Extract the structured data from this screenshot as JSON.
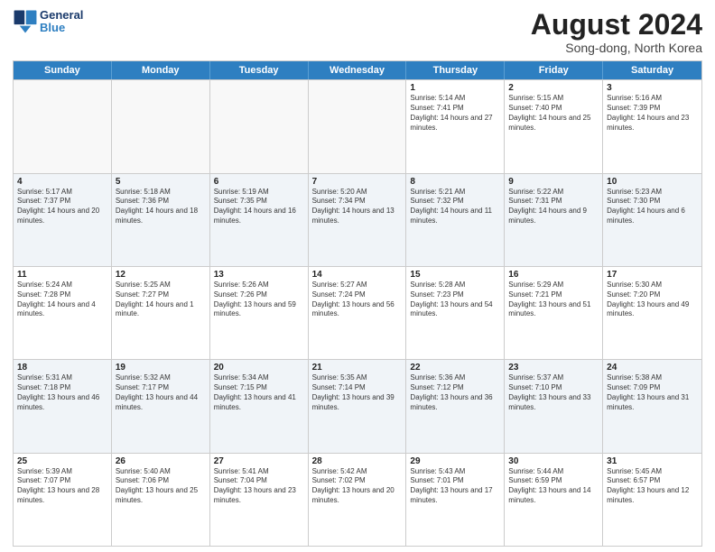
{
  "header": {
    "logo_general": "General",
    "logo_blue": "Blue",
    "month_title": "August 2024",
    "subtitle": "Song-dong, North Korea"
  },
  "calendar": {
    "days_of_week": [
      "Sunday",
      "Monday",
      "Tuesday",
      "Wednesday",
      "Thursday",
      "Friday",
      "Saturday"
    ],
    "weeks": [
      [
        {
          "day": "",
          "info": ""
        },
        {
          "day": "",
          "info": ""
        },
        {
          "day": "",
          "info": ""
        },
        {
          "day": "",
          "info": ""
        },
        {
          "day": "1",
          "sunrise": "Sunrise: 5:14 AM",
          "sunset": "Sunset: 7:41 PM",
          "daylight": "Daylight: 14 hours and 27 minutes."
        },
        {
          "day": "2",
          "sunrise": "Sunrise: 5:15 AM",
          "sunset": "Sunset: 7:40 PM",
          "daylight": "Daylight: 14 hours and 25 minutes."
        },
        {
          "day": "3",
          "sunrise": "Sunrise: 5:16 AM",
          "sunset": "Sunset: 7:39 PM",
          "daylight": "Daylight: 14 hours and 23 minutes."
        }
      ],
      [
        {
          "day": "4",
          "sunrise": "Sunrise: 5:17 AM",
          "sunset": "Sunset: 7:37 PM",
          "daylight": "Daylight: 14 hours and 20 minutes."
        },
        {
          "day": "5",
          "sunrise": "Sunrise: 5:18 AM",
          "sunset": "Sunset: 7:36 PM",
          "daylight": "Daylight: 14 hours and 18 minutes."
        },
        {
          "day": "6",
          "sunrise": "Sunrise: 5:19 AM",
          "sunset": "Sunset: 7:35 PM",
          "daylight": "Daylight: 14 hours and 16 minutes."
        },
        {
          "day": "7",
          "sunrise": "Sunrise: 5:20 AM",
          "sunset": "Sunset: 7:34 PM",
          "daylight": "Daylight: 14 hours and 13 minutes."
        },
        {
          "day": "8",
          "sunrise": "Sunrise: 5:21 AM",
          "sunset": "Sunset: 7:32 PM",
          "daylight": "Daylight: 14 hours and 11 minutes."
        },
        {
          "day": "9",
          "sunrise": "Sunrise: 5:22 AM",
          "sunset": "Sunset: 7:31 PM",
          "daylight": "Daylight: 14 hours and 9 minutes."
        },
        {
          "day": "10",
          "sunrise": "Sunrise: 5:23 AM",
          "sunset": "Sunset: 7:30 PM",
          "daylight": "Daylight: 14 hours and 6 minutes."
        }
      ],
      [
        {
          "day": "11",
          "sunrise": "Sunrise: 5:24 AM",
          "sunset": "Sunset: 7:28 PM",
          "daylight": "Daylight: 14 hours and 4 minutes."
        },
        {
          "day": "12",
          "sunrise": "Sunrise: 5:25 AM",
          "sunset": "Sunset: 7:27 PM",
          "daylight": "Daylight: 14 hours and 1 minute."
        },
        {
          "day": "13",
          "sunrise": "Sunrise: 5:26 AM",
          "sunset": "Sunset: 7:26 PM",
          "daylight": "Daylight: 13 hours and 59 minutes."
        },
        {
          "day": "14",
          "sunrise": "Sunrise: 5:27 AM",
          "sunset": "Sunset: 7:24 PM",
          "daylight": "Daylight: 13 hours and 56 minutes."
        },
        {
          "day": "15",
          "sunrise": "Sunrise: 5:28 AM",
          "sunset": "Sunset: 7:23 PM",
          "daylight": "Daylight: 13 hours and 54 minutes."
        },
        {
          "day": "16",
          "sunrise": "Sunrise: 5:29 AM",
          "sunset": "Sunset: 7:21 PM",
          "daylight": "Daylight: 13 hours and 51 minutes."
        },
        {
          "day": "17",
          "sunrise": "Sunrise: 5:30 AM",
          "sunset": "Sunset: 7:20 PM",
          "daylight": "Daylight: 13 hours and 49 minutes."
        }
      ],
      [
        {
          "day": "18",
          "sunrise": "Sunrise: 5:31 AM",
          "sunset": "Sunset: 7:18 PM",
          "daylight": "Daylight: 13 hours and 46 minutes."
        },
        {
          "day": "19",
          "sunrise": "Sunrise: 5:32 AM",
          "sunset": "Sunset: 7:17 PM",
          "daylight": "Daylight: 13 hours and 44 minutes."
        },
        {
          "day": "20",
          "sunrise": "Sunrise: 5:34 AM",
          "sunset": "Sunset: 7:15 PM",
          "daylight": "Daylight: 13 hours and 41 minutes."
        },
        {
          "day": "21",
          "sunrise": "Sunrise: 5:35 AM",
          "sunset": "Sunset: 7:14 PM",
          "daylight": "Daylight: 13 hours and 39 minutes."
        },
        {
          "day": "22",
          "sunrise": "Sunrise: 5:36 AM",
          "sunset": "Sunset: 7:12 PM",
          "daylight": "Daylight: 13 hours and 36 minutes."
        },
        {
          "day": "23",
          "sunrise": "Sunrise: 5:37 AM",
          "sunset": "Sunset: 7:10 PM",
          "daylight": "Daylight: 13 hours and 33 minutes."
        },
        {
          "day": "24",
          "sunrise": "Sunrise: 5:38 AM",
          "sunset": "Sunset: 7:09 PM",
          "daylight": "Daylight: 13 hours and 31 minutes."
        }
      ],
      [
        {
          "day": "25",
          "sunrise": "Sunrise: 5:39 AM",
          "sunset": "Sunset: 7:07 PM",
          "daylight": "Daylight: 13 hours and 28 minutes."
        },
        {
          "day": "26",
          "sunrise": "Sunrise: 5:40 AM",
          "sunset": "Sunset: 7:06 PM",
          "daylight": "Daylight: 13 hours and 25 minutes."
        },
        {
          "day": "27",
          "sunrise": "Sunrise: 5:41 AM",
          "sunset": "Sunset: 7:04 PM",
          "daylight": "Daylight: 13 hours and 23 minutes."
        },
        {
          "day": "28",
          "sunrise": "Sunrise: 5:42 AM",
          "sunset": "Sunset: 7:02 PM",
          "daylight": "Daylight: 13 hours and 20 minutes."
        },
        {
          "day": "29",
          "sunrise": "Sunrise: 5:43 AM",
          "sunset": "Sunset: 7:01 PM",
          "daylight": "Daylight: 13 hours and 17 minutes."
        },
        {
          "day": "30",
          "sunrise": "Sunrise: 5:44 AM",
          "sunset": "Sunset: 6:59 PM",
          "daylight": "Daylight: 13 hours and 14 minutes."
        },
        {
          "day": "31",
          "sunrise": "Sunrise: 5:45 AM",
          "sunset": "Sunset: 6:57 PM",
          "daylight": "Daylight: 13 hours and 12 minutes."
        }
      ]
    ]
  }
}
